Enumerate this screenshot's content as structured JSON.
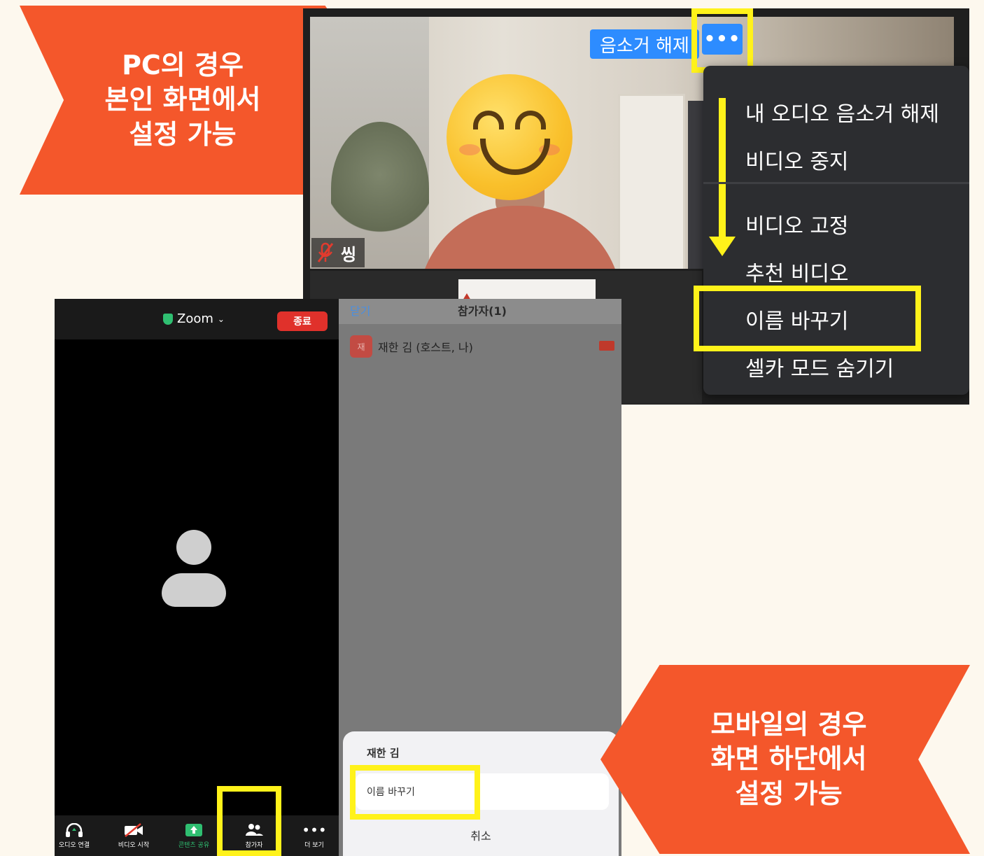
{
  "callouts": {
    "pc": [
      "PC의 경우",
      "본인 화면에서",
      "설정 가능"
    ],
    "mobile": [
      "모바일의 경우",
      "화면 하단에서",
      "설정 가능"
    ]
  },
  "pc": {
    "unmute_label": "음소거 해제",
    "more_label": "•••",
    "name_tag": "씽",
    "menu": {
      "items": [
        "내 오디오 음소거 해제",
        "비디오 중지",
        "비디오 고정",
        "추천 비디오",
        "이름 바꾸기",
        "셀카 모드 숨기기"
      ],
      "highlighted": "이름 바꾸기"
    }
  },
  "mobile": {
    "app_title": "Zoom",
    "end_label": "종료",
    "toolbar": [
      {
        "icon": "headphones-icon",
        "label": "오디오 연결"
      },
      {
        "icon": "video-off-icon",
        "label": "비디오 시작"
      },
      {
        "icon": "share-screen-icon",
        "label": "콘텐츠 공유"
      },
      {
        "icon": "participants-icon",
        "label": "참가자"
      },
      {
        "icon": "more-icon",
        "label": "더 보기"
      }
    ],
    "panel": {
      "close_label": "닫기",
      "title": "참가자(1)",
      "participant_initial": "재",
      "participant_name": "재한 김 (호스트, 나)",
      "sheet_name": "재한 김",
      "rename_label": "이름 바꾸기",
      "cancel_label": "취소"
    }
  },
  "colors": {
    "callout": "#f4572b",
    "highlight": "#fff21a",
    "zoom_blue": "#2d8cff",
    "background": "#fdf8ee"
  }
}
